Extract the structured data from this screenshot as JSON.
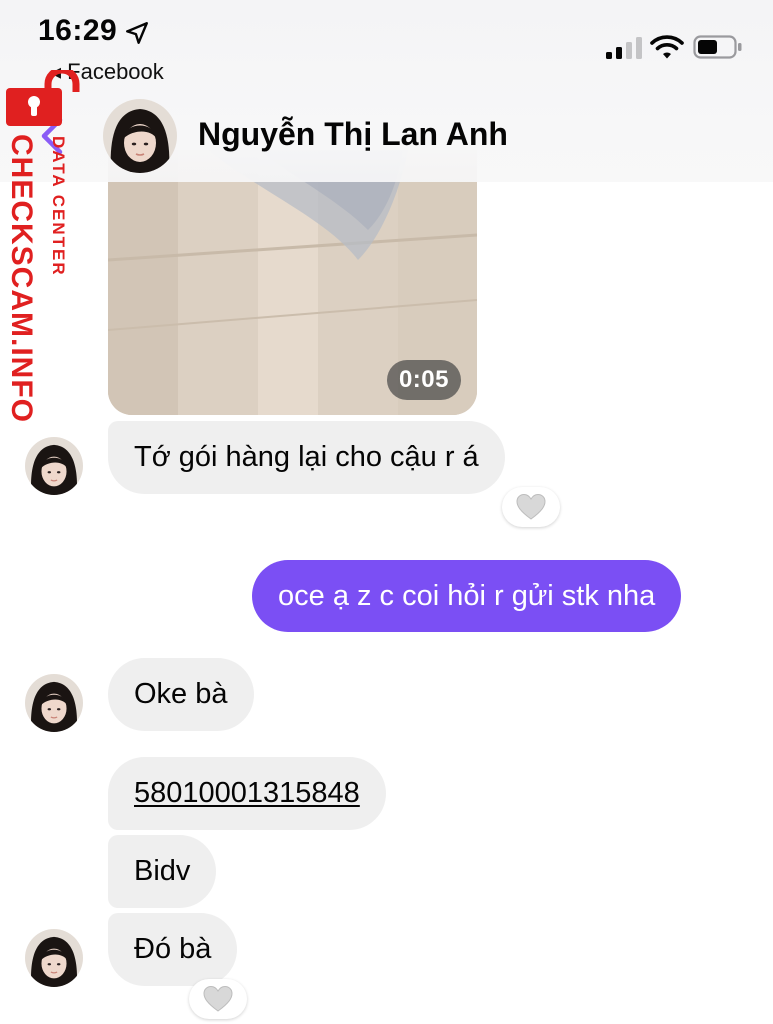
{
  "status_bar": {
    "time": "16:29",
    "back_app": "◂ Facebook"
  },
  "header": {
    "contact_name": "Nguyễn Thị Lan Anh"
  },
  "watermark": {
    "site": "CHECKSCAM.INFO",
    "tagline": "DATA CENTER"
  },
  "messages": {
    "video": {
      "duration": "0:05"
    },
    "m1": {
      "text": "Tớ gói hàng lại cho cậu r á",
      "reaction": "heart-icon"
    },
    "m2": {
      "text": "oce ạ z c coi hỏi r gửi stk nha"
    },
    "m3": {
      "text": "Oke bà"
    },
    "m4": {
      "text": "58010001315848"
    },
    "m5": {
      "text": "Bidv"
    },
    "m6": {
      "text": "Đó bà",
      "reaction": "heart-icon"
    }
  },
  "colors": {
    "outgoing_bubble": "#7b4ff4",
    "incoming_bubble": "#efefef",
    "watermark": "#e02020"
  }
}
